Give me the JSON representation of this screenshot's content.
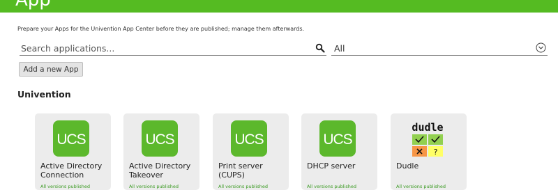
{
  "header": {
    "title": "App"
  },
  "intro_text": "Prepare your Apps for the Univention App Center before they are published; manage them afterwards.",
  "search": {
    "placeholder": "Search applications...",
    "value": "",
    "icon": "search-icon"
  },
  "filter": {
    "selected": "All",
    "icon": "chevron-down-icon"
  },
  "add_button": {
    "label": "Add a new App"
  },
  "section": {
    "title": "Univention"
  },
  "apps": [
    {
      "name": "Active Directory Connection",
      "status": "All versions published",
      "logo": "ucs-logo",
      "logo_text": "UCS"
    },
    {
      "name": "Active Directory Takeover",
      "status": "All versions published",
      "logo": "ucs-logo",
      "logo_text": "UCS"
    },
    {
      "name": "Print server (CUPS)",
      "status": "All versions published",
      "logo": "ucs-logo",
      "logo_text": "UCS"
    },
    {
      "name": "DHCP server",
      "status": "All versions published",
      "logo": "ucs-logo",
      "logo_text": "UCS"
    },
    {
      "name": "Dudle",
      "status": "All versions published",
      "logo": "dudle-logo",
      "logo_text": "dudle"
    }
  ],
  "colors": {
    "brand_green": "#55bb22",
    "status_green": "#3a9a22",
    "tile_bg": "#ececec"
  }
}
